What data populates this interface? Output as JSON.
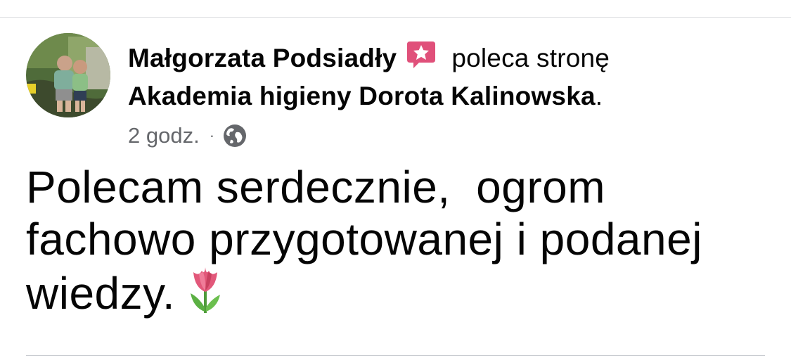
{
  "post": {
    "author_name": "Małgorzata Podsiadły",
    "recommendation_text": "poleca stronę",
    "page_name": "Akademia higieny Dorota Kalinowska",
    "page_name_suffix": ".",
    "timestamp": "2 godz.",
    "separator": "·",
    "audience_icon": "globe-icon",
    "badge_icon": "recommendation-star-icon",
    "body_lines": [
      "Polecam serdecznie,  ogrom",
      "fachowo przygotowanej i podanej",
      "wiedzy."
    ],
    "body_emoji": "tulip-emoji",
    "colors": {
      "badge": "#e0507a",
      "secondary_text": "#65676b",
      "primary_text": "#050505"
    }
  }
}
